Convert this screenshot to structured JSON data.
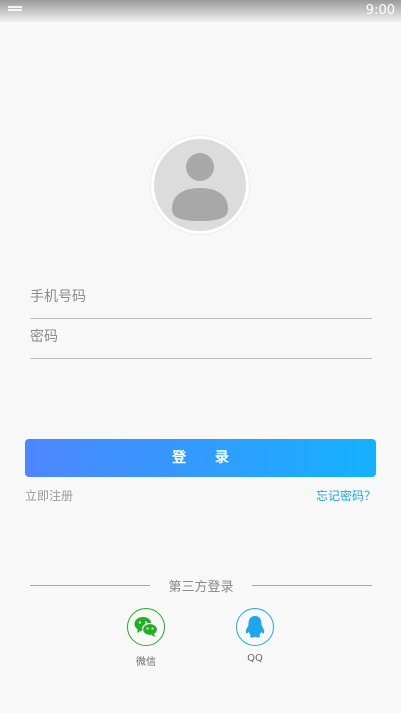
{
  "status_bar": {
    "time": "9:00"
  },
  "login_form": {
    "phone_placeholder": "手机号码",
    "password_placeholder": "密码",
    "login_label": "登 录"
  },
  "links": {
    "register": "立即注册",
    "forgot_password": "忘记密码？"
  },
  "third_party": {
    "title": "第三方登录",
    "options": [
      {
        "label": "微信",
        "icon": "wechat-icon",
        "color": "#22b022"
      },
      {
        "label": "QQ",
        "icon": "qq-icon",
        "color": "#1fa5f0"
      }
    ]
  },
  "colors": {
    "accent_start": "#4e86ff",
    "accent_end": "#15b1ff",
    "link": "#19a6ee"
  }
}
